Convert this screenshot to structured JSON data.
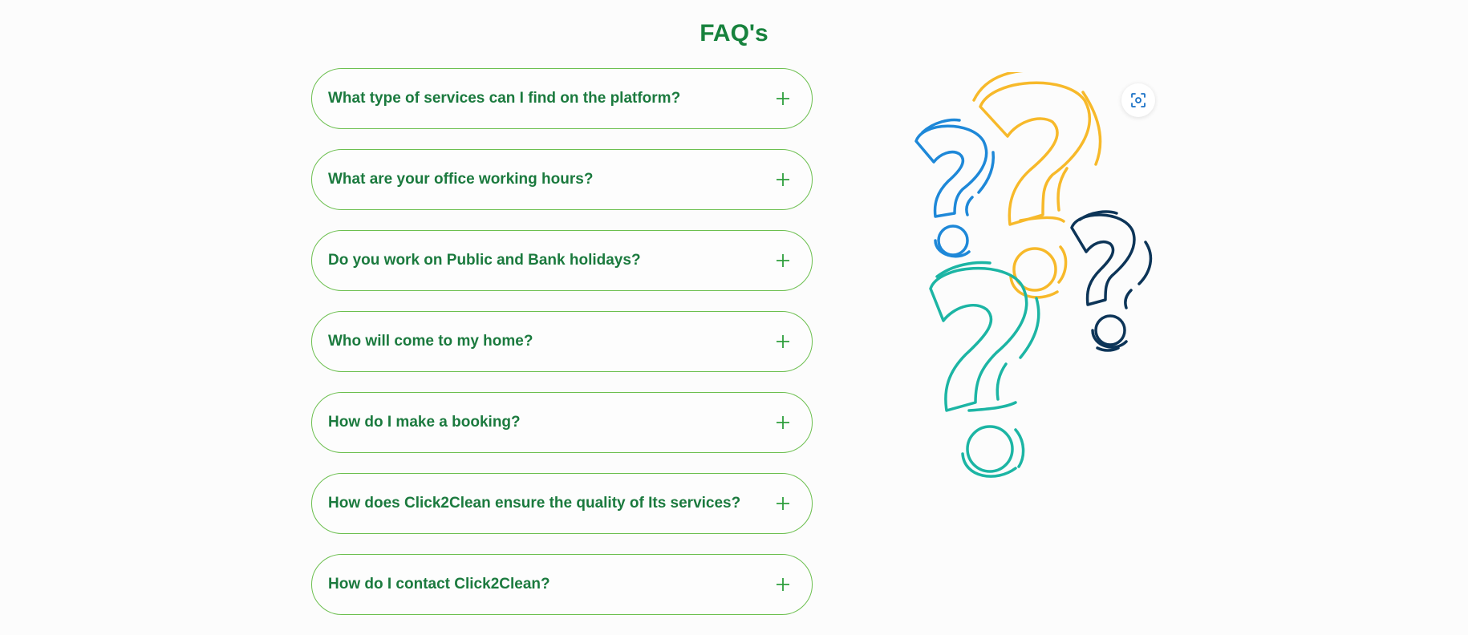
{
  "page": {
    "title": "FAQ's"
  },
  "faq": {
    "items": [
      {
        "question": "What type of services can I find on the platform?"
      },
      {
        "question": "What are your office working hours?"
      },
      {
        "question": "Do you work on Public and Bank holidays?"
      },
      {
        "question": "Who will come to my home?"
      },
      {
        "question": "How do I make a booking?"
      },
      {
        "question": "How does Click2Clean ensure the quality of Its services?"
      },
      {
        "question": "How do I contact Click2Clean?"
      }
    ],
    "expand_icon": "plus-icon"
  },
  "illustration": {
    "icon": "question-marks-illustration",
    "colors": [
      "#f7b92a",
      "#1e88d8",
      "#0d3558",
      "#1cb5a4"
    ]
  },
  "scan_button": {
    "icon": "scan-icon",
    "color": "#1b72c7"
  },
  "colors": {
    "brand_green": "#17823d",
    "border_green": "#6cbf4f",
    "plus_green": "#2e9e3c",
    "background": "#fcfcfc"
  }
}
